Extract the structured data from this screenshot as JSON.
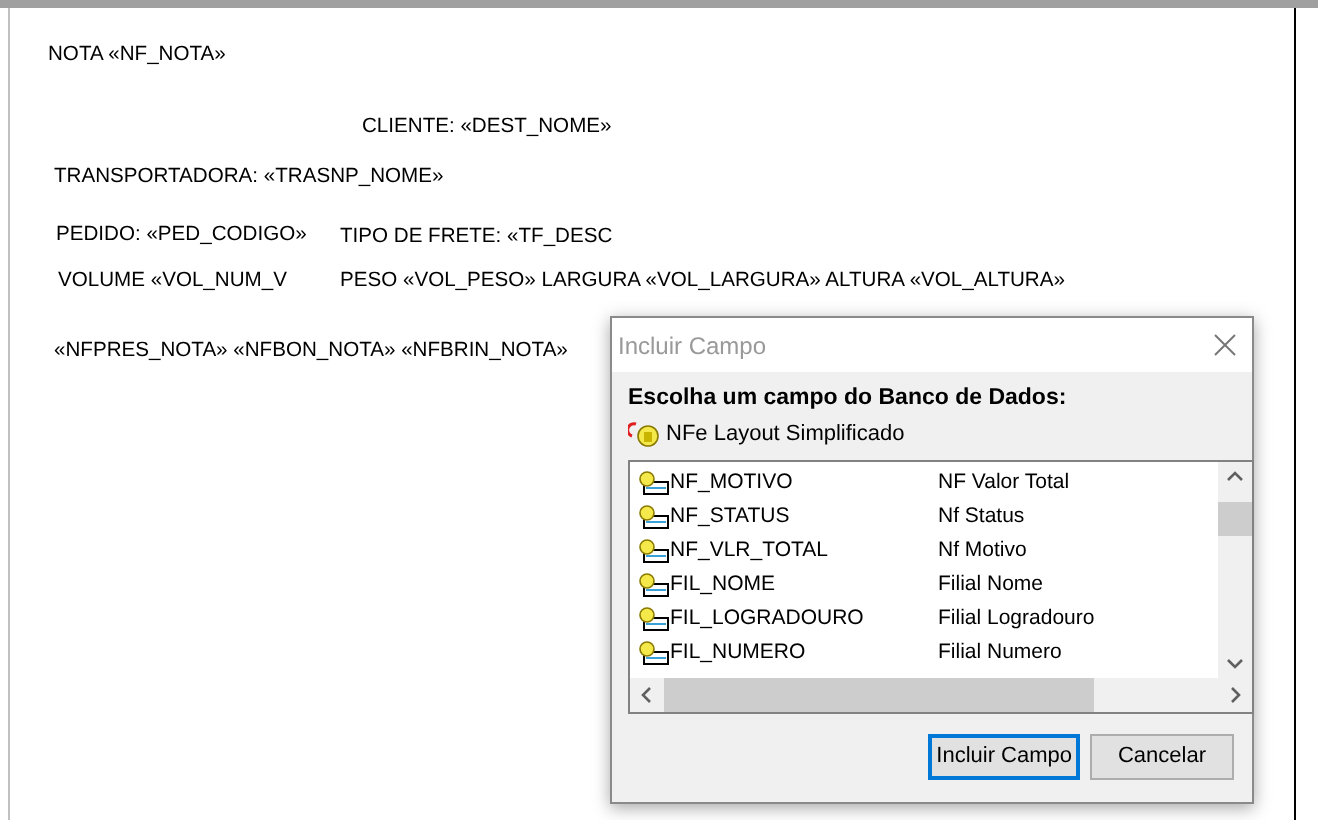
{
  "report": {
    "fields": [
      "NOTA «NF_NOTA»",
      "CLIENTE: «DEST_NOME»",
      "TRANSPORTADORA: «TRASNP_NOME»",
      "PEDIDO: «PED_CODIGO»",
      "TIPO DE FRETE: «TF_DESC",
      "VOLUME «VOL_NUM_V",
      "PESO «VOL_PESO» LARGURA «VOL_LARGURA» ALTURA «VOL_ALTURA»",
      "«NFPRES_NOTA» «NFBON_NOTA» «NFBRIN_NOTA»"
    ]
  },
  "dialog": {
    "title": "Incluir Campo",
    "heading": "Escolha um campo do Banco de Dados:",
    "source": "NFe Layout Simplificado",
    "fields": [
      {
        "name": "NF_MOTIVO",
        "description": "NF Valor Total"
      },
      {
        "name": "NF_STATUS",
        "description": "Nf Status"
      },
      {
        "name": "NF_VLR_TOTAL",
        "description": "Nf Motivo"
      },
      {
        "name": "FIL_NOME",
        "description": "Filial Nome"
      },
      {
        "name": "FIL_LOGRADOURO",
        "description": "Filial Logradouro"
      },
      {
        "name": "FIL_NUMERO",
        "description": "Filial Numero"
      }
    ],
    "buttons": [
      {
        "label": "Incluir Campo",
        "default": true
      },
      {
        "label": "Cancelar",
        "default": false
      }
    ]
  }
}
